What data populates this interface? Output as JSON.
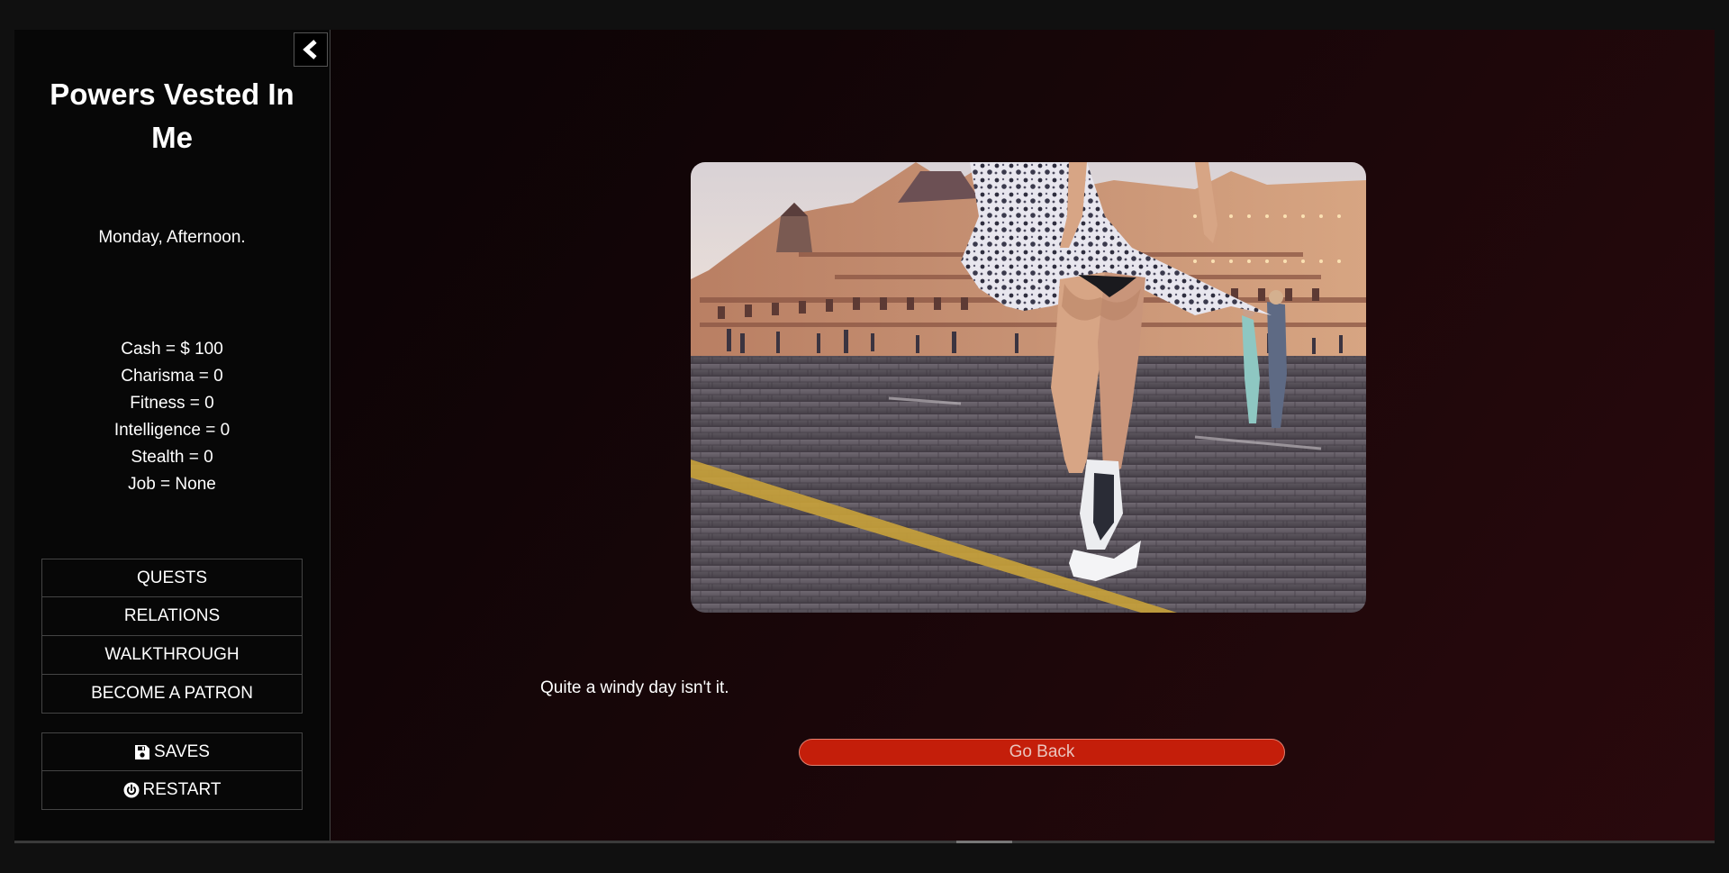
{
  "sidebar": {
    "title": "Powers Vested In Me",
    "date": "Monday, Afternoon.",
    "stats": [
      "Cash = $ 100",
      "Charisma = 0",
      "Fitness = 0",
      "Intelligence = 0",
      "Stealth = 0",
      "Job = None"
    ],
    "menu": [
      "QUESTS",
      "RELATIONS",
      "WALKTHROUGH",
      "BECOME A PATRON"
    ],
    "saves_label": "SAVES",
    "restart_label": "RESTART",
    "icons": {
      "collapse": "chevron-left-icon",
      "saves": "floppy-disk-icon",
      "restart": "power-icon"
    }
  },
  "passage": {
    "text": "Quite a windy day isn't it.",
    "go_back_label": "Go Back"
  },
  "colors": {
    "accent_button": "#c41e0a",
    "background_dark": "#070707"
  }
}
